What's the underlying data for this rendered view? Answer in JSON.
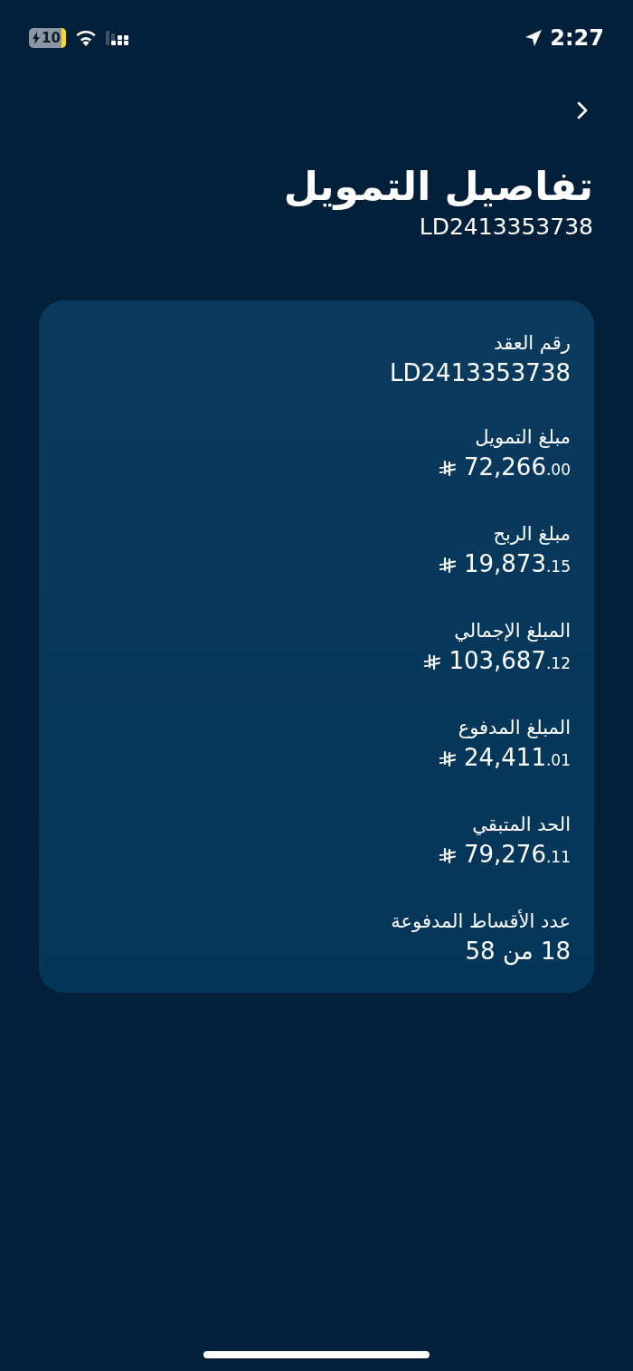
{
  "status_bar": {
    "time": "2:27",
    "battery": "10",
    "charging": true
  },
  "title": "تفاصيل التمويل",
  "subtitle": "LD2413353738",
  "details": [
    {
      "kind": "text",
      "label": "رقم العقد",
      "value": "LD2413353738"
    },
    {
      "kind": "amount",
      "label": "مبلغ التمويل",
      "integer": "72,266",
      "decimals": ".00"
    },
    {
      "kind": "amount",
      "label": "مبلغ الربح",
      "integer": "19,873",
      "decimals": ".15"
    },
    {
      "kind": "amount",
      "label": "المبلغ الإجمالي",
      "integer": "103,687",
      "decimals": ".12"
    },
    {
      "kind": "amount",
      "label": "المبلغ المدفوع",
      "integer": "24,411",
      "decimals": ".01"
    },
    {
      "kind": "amount",
      "label": "الحد المتبقي",
      "integer": "79,276",
      "decimals": ".11"
    },
    {
      "kind": "text",
      "label": "عدد الأقساط المدفوعة",
      "value": "18 من 58"
    }
  ]
}
